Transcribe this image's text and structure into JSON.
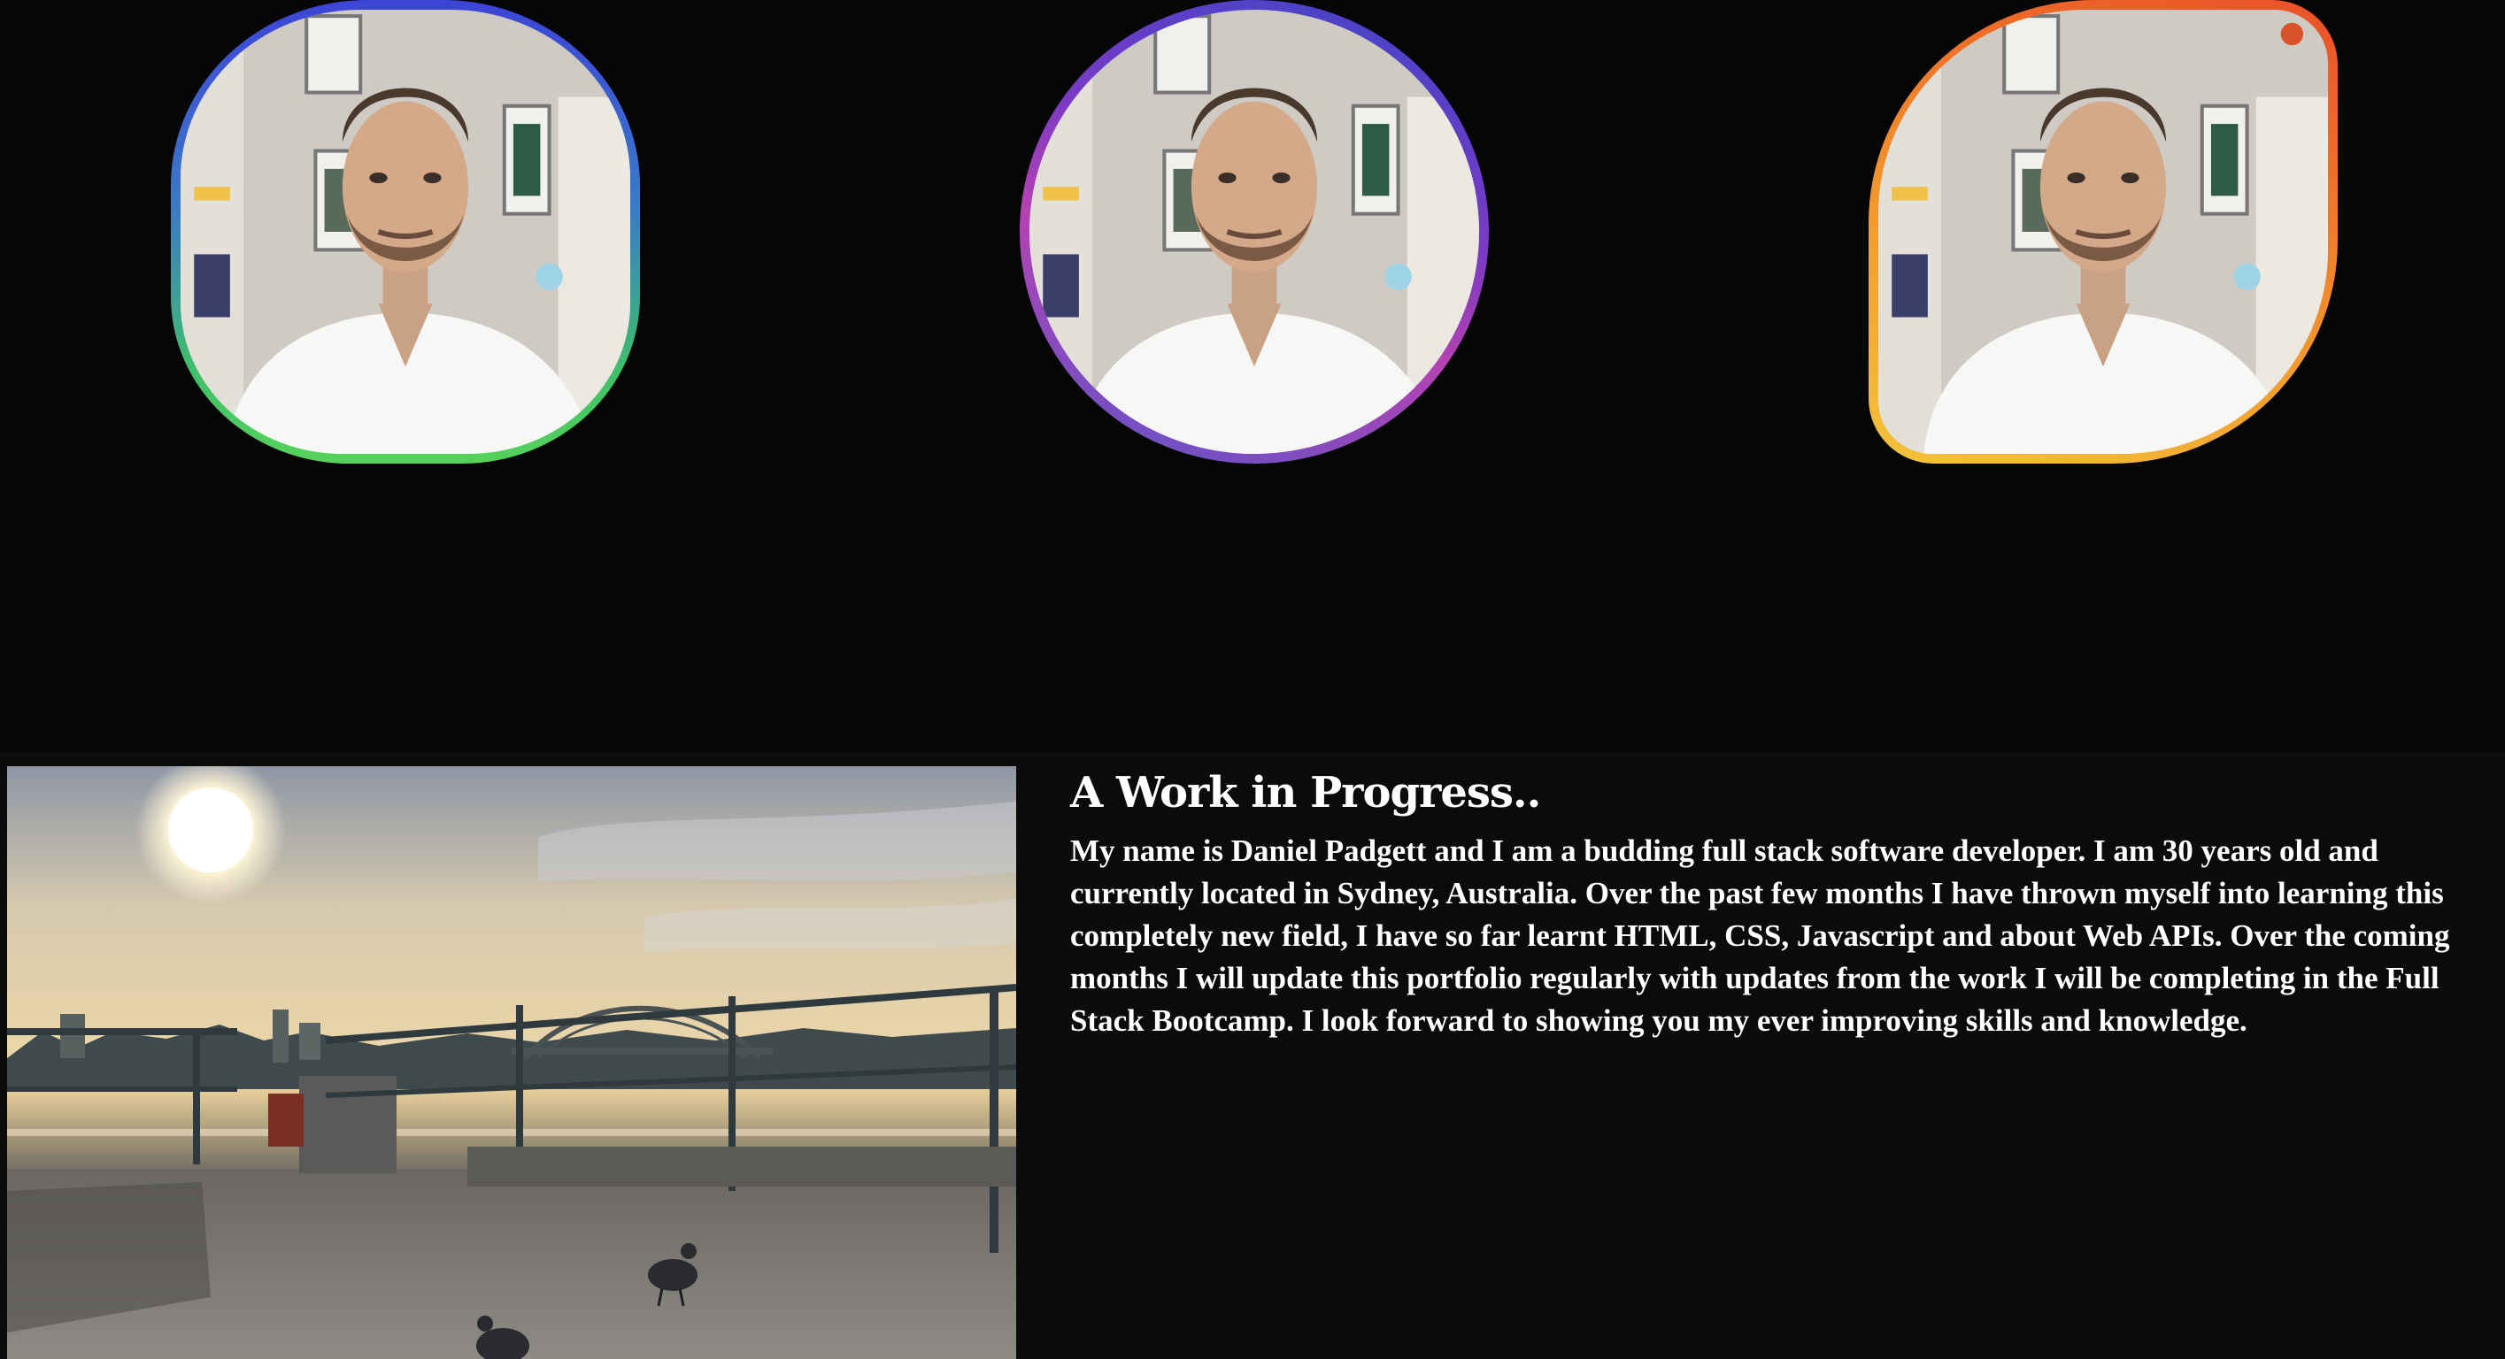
{
  "avatars": [
    {
      "name": "avatar-square-rounded",
      "frame_colors": [
        "#3d44d6",
        "#56d25b"
      ],
      "alt": "Portrait of Daniel Padgett"
    },
    {
      "name": "avatar-circle",
      "frame_colors": [
        "#3c46c9",
        "#b542b1"
      ],
      "alt": "Portrait of Daniel Padgett"
    },
    {
      "name": "avatar-leaf",
      "frame_colors": [
        "#f3c33a",
        "#e9502a"
      ],
      "alt": "Portrait of Daniel Padgett"
    }
  ],
  "about": {
    "title": "A Work in Progress..",
    "body": "My name is Daniel Padgett and I am a budding full stack software developer. I am 30 years old and currently located in Sydney, Australia. Over the past few months I have thrown myself into learning this completely new field, I have so far learnt HTML, CSS, Javascript and about Web APIs. Over the coming months I will update this portfolio regularly with updates from the work I will be completing in the Full Stack Bootcamp. I look forward to showing you my ever improving skills and knowledge.",
    "image_alt": "Sydney Harbour Bridge at sunrise"
  },
  "colors": {
    "background": "#070708",
    "text": "#ffffff"
  }
}
